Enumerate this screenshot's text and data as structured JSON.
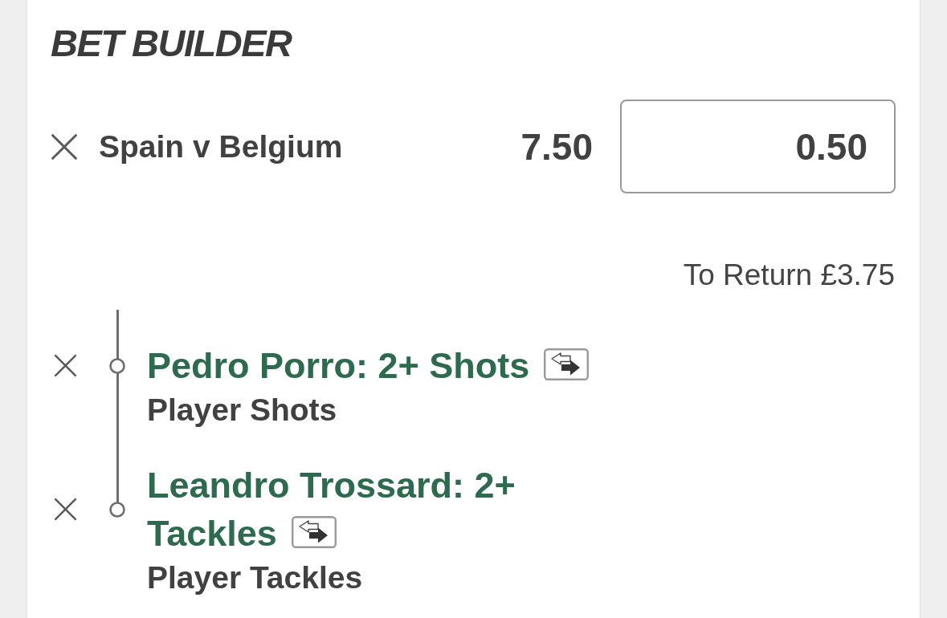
{
  "panel": {
    "title": "BET BUILDER"
  },
  "bet": {
    "event": "Spain v Belgium",
    "odds": "7.50",
    "stake": "0.50",
    "to_return": "To Return £3.75"
  },
  "legs": [
    {
      "selection_lines": [
        "Pedro Porro: 2+ Shots"
      ],
      "market": "Player Shots"
    },
    {
      "selection_lines": [
        "Leandro Trossard: 2+",
        "Tackles"
      ],
      "market": "Player Tackles"
    }
  ]
}
